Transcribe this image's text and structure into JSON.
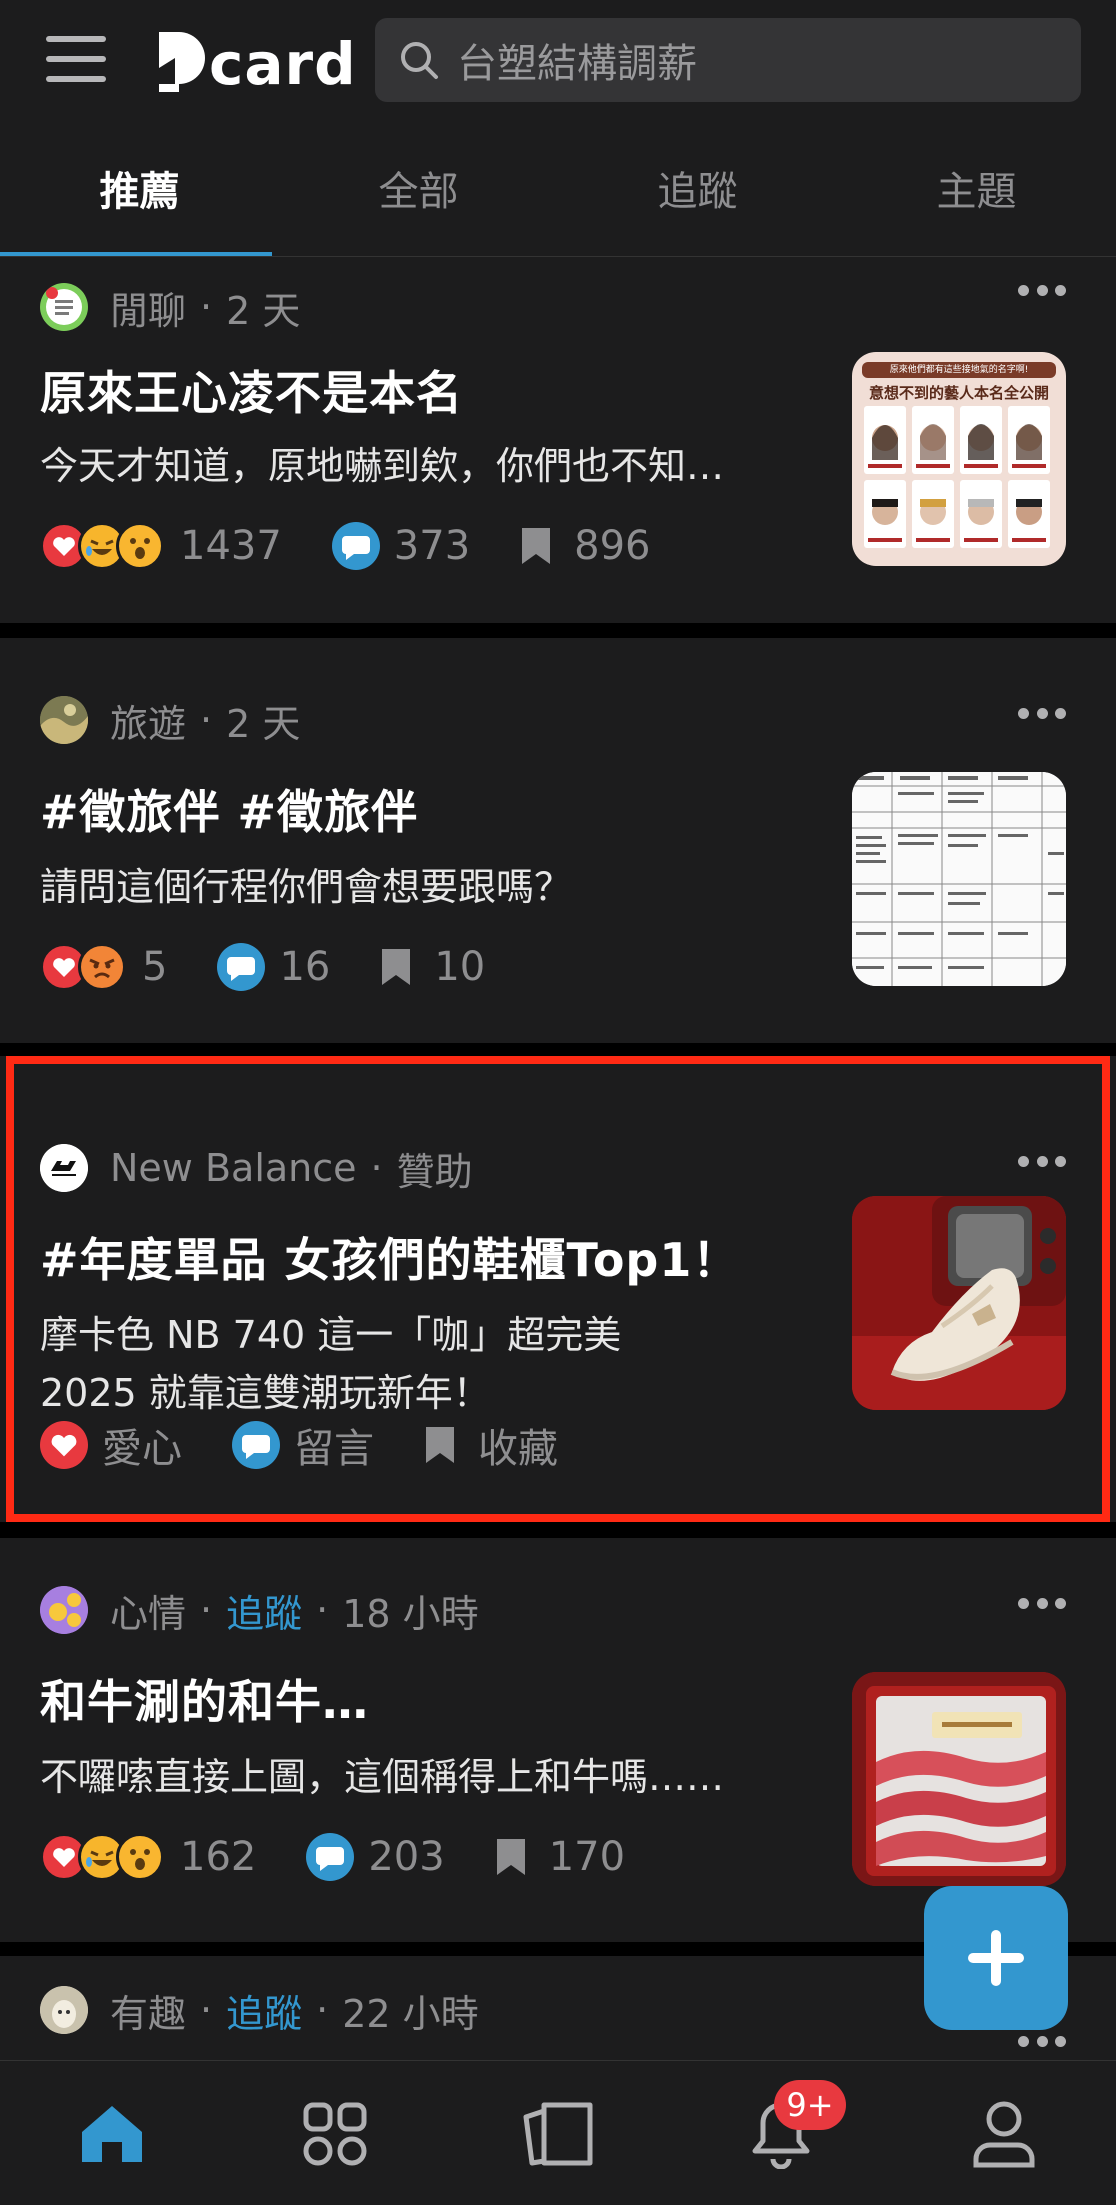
{
  "app": {
    "logo_text": "card",
    "brand_color": "#3397cf"
  },
  "search": {
    "placeholder": "台塑結構調薪"
  },
  "tabs": [
    {
      "label": "推薦",
      "active": true
    },
    {
      "label": "全部"
    },
    {
      "label": "追蹤"
    },
    {
      "label": "主題"
    }
  ],
  "posts": [
    {
      "forum": "閒聊",
      "time": "2 天",
      "title": "原來王心凌不是本名",
      "excerpt": "今天才知道，原地嚇到欸，你們也不知…",
      "likes": "1437",
      "comments": "373",
      "bookmarks": "896",
      "thumb_heading": "原來他們都有這些接地氣的名字啊!",
      "thumb_title": "意想不到的藝人本名全公開"
    },
    {
      "forum": "旅遊",
      "time": "2 天",
      "title": "#徵旅伴 #徵旅伴",
      "excerpt": "請問這個行程你們會想要跟嗎？",
      "likes": "5",
      "comments": "16",
      "bookmarks": "10"
    },
    {
      "forum": "New Balance",
      "time": "贊助",
      "title": "#年度單品 女孩們的鞋櫃Top1！",
      "excerpt_line1": "摩卡色 NB 740 這一「咖」超完美",
      "excerpt_line2": "2025 就靠這雙潮玩新年！",
      "like_label": "愛心",
      "comment_label": "留言",
      "bookmark_label": "收藏"
    },
    {
      "forum": "心情",
      "follow": "追蹤",
      "time": "18 小時",
      "title": "和牛涮的和牛…",
      "excerpt": "不囉嗦直接上圖，這個稱得上和牛嗎……",
      "likes": "162",
      "comments": "203",
      "bookmarks": "170"
    },
    {
      "forum": "有趣",
      "follow": "追蹤",
      "time": "22 小時"
    }
  ],
  "notifications": {
    "badge": "9+"
  },
  "icons": [
    "hamburger-icon",
    "search-icon",
    "more-icon",
    "heart-icon",
    "comment-icon",
    "bookmark-icon",
    "plus-icon",
    "home-icon",
    "grid-icon",
    "cards-icon",
    "bell-icon",
    "profile-icon"
  ]
}
